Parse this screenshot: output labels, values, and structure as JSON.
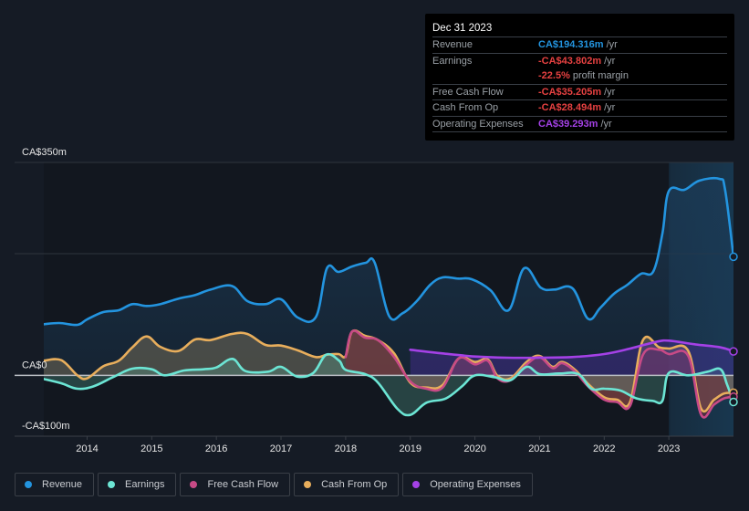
{
  "tooltip": {
    "date": "Dec 31 2023",
    "rows": [
      {
        "label": "Revenue",
        "value": "CA$194.316m",
        "unit": "/yr",
        "color": "#2394df"
      },
      {
        "label": "Earnings",
        "value": "-CA$43.802m",
        "unit": "/yr",
        "color": "#e64141"
      },
      {
        "label": "",
        "value": "-22.5%",
        "unit": "profit margin",
        "color": "#e64141"
      },
      {
        "label": "Free Cash Flow",
        "value": "-CA$35.205m",
        "unit": "/yr",
        "color": "#e64141"
      },
      {
        "label": "Cash From Op",
        "value": "-CA$28.494m",
        "unit": "/yr",
        "color": "#e64141"
      },
      {
        "label": "Operating Expenses",
        "value": "CA$39.293m",
        "unit": "/yr",
        "color": "#a441e6"
      }
    ]
  },
  "legend": [
    {
      "label": "Revenue",
      "color": "#2394df"
    },
    {
      "label": "Earnings",
      "color": "#6ce5d4"
    },
    {
      "label": "Free Cash Flow",
      "color": "#c74a86"
    },
    {
      "label": "Cash From Op",
      "color": "#e8ae5c"
    },
    {
      "label": "Operating Expenses",
      "color": "#a441e6"
    }
  ],
  "chart_data": {
    "type": "line",
    "title": "",
    "xlabel": "",
    "ylabel": "",
    "y_tick_labels": [
      "CA$350m",
      "CA$0",
      "-CA$100m"
    ],
    "y_ticks": [
      350,
      0,
      -100
    ],
    "ylim": [
      -100,
      350
    ],
    "xlim": [
      2013.33,
      2024.0
    ],
    "x_tick_labels": [
      "2014",
      "2015",
      "2016",
      "2017",
      "2018",
      "2019",
      "2020",
      "2021",
      "2022",
      "2023"
    ],
    "x_ticks": [
      2014,
      2015,
      2016,
      2017,
      2018,
      2019,
      2020,
      2021,
      2022,
      2023
    ],
    "highlight_from": 2023.0,
    "legend_position": "bottom-left",
    "grid": true,
    "series": [
      {
        "name": "Revenue",
        "color": "#2394df",
        "x": [
          2013.33,
          2013.57,
          2013.85,
          2014.0,
          2014.25,
          2014.49,
          2014.7,
          2014.92,
          2015.13,
          2015.41,
          2015.67,
          2015.91,
          2016.24,
          2016.48,
          2016.76,
          2017.0,
          2017.26,
          2017.54,
          2017.71,
          2017.89,
          2018.1,
          2018.31,
          2018.45,
          2018.67,
          2018.88,
          2019.1,
          2019.31,
          2019.5,
          2019.74,
          2019.95,
          2020.24,
          2020.52,
          2020.76,
          2021.02,
          2021.23,
          2021.51,
          2021.75,
          2021.94,
          2022.15,
          2022.36,
          2022.57,
          2022.76,
          2022.9,
          2023.0,
          2023.24,
          2023.47,
          2023.78,
          2023.87,
          2024.0
        ],
        "values": [
          84,
          86,
          83,
          92,
          104,
          107,
          117,
          114,
          117,
          126,
          132,
          141,
          147,
          122,
          117,
          125,
          95,
          96,
          176,
          170,
          179,
          185,
          185,
          98,
          102,
          122,
          149,
          161,
          159,
          158,
          140,
          107,
          176,
          144,
          141,
          143,
          93,
          111,
          134,
          149,
          167,
          171,
          233,
          303,
          305,
          320,
          323,
          305,
          195
        ]
      },
      {
        "name": "Earnings",
        "color": "#6ce5d4",
        "x": [
          2013.33,
          2013.6,
          2013.85,
          2014.1,
          2014.4,
          2014.7,
          2015.0,
          2015.2,
          2015.5,
          2015.8,
          2016.0,
          2016.25,
          2016.45,
          2016.8,
          2017.0,
          2017.25,
          2017.5,
          2017.7,
          2017.9,
          2018.0,
          2018.3,
          2018.5,
          2018.8,
          2019.0,
          2019.25,
          2019.55,
          2019.8,
          2020.0,
          2020.3,
          2020.55,
          2020.8,
          2021.0,
          2021.3,
          2021.6,
          2021.8,
          2022.0,
          2022.25,
          2022.5,
          2022.75,
          2022.9,
          2023.0,
          2023.3,
          2023.6,
          2023.8,
          2023.9,
          2024.0
        ],
        "values": [
          -6,
          -13,
          -22,
          -18,
          -3,
          11,
          10,
          0,
          8,
          10,
          13,
          27,
          7,
          6,
          14,
          -2,
          4,
          34,
          24,
          9,
          2,
          -12,
          -55,
          -65,
          -45,
          -38,
          -18,
          0,
          -3,
          -8,
          14,
          2,
          3,
          2,
          -22,
          -22,
          -25,
          -38,
          -42,
          -42,
          4,
          0,
          6,
          10,
          -15,
          -43.8
        ]
      },
      {
        "name": "Free Cash Flow",
        "color": "#c74a86",
        "x": [
          2018.0,
          2018.1,
          2018.3,
          2018.5,
          2018.75,
          2019.0,
          2019.25,
          2019.5,
          2019.75,
          2020.0,
          2020.2,
          2020.35,
          2020.55,
          2020.8,
          2021.0,
          2021.2,
          2021.35,
          2021.55,
          2021.75,
          2022.0,
          2022.2,
          2022.4,
          2022.6,
          2022.85,
          2023.0,
          2023.3,
          2023.5,
          2023.7,
          2023.85,
          2024.0
        ],
        "values": [
          30,
          72,
          62,
          58,
          30,
          -10,
          -22,
          -20,
          28,
          18,
          24,
          -5,
          -8,
          18,
          30,
          12,
          20,
          6,
          -18,
          -40,
          -44,
          -50,
          34,
          42,
          35,
          32,
          -65,
          -48,
          -38,
          -35.2
        ]
      },
      {
        "name": "Cash From Op",
        "color": "#e8ae5c",
        "x": [
          2013.33,
          2013.6,
          2013.85,
          2014.0,
          2014.25,
          2014.49,
          2014.7,
          2014.92,
          2015.13,
          2015.41,
          2015.67,
          2015.91,
          2016.24,
          2016.48,
          2016.76,
          2017.0,
          2017.26,
          2017.54,
          2017.71,
          2017.89,
          2018.0,
          2018.1,
          2018.3,
          2018.5,
          2018.75,
          2019.0,
          2019.25,
          2019.5,
          2019.75,
          2020.0,
          2020.2,
          2020.35,
          2020.55,
          2020.8,
          2021.0,
          2021.2,
          2021.35,
          2021.55,
          2021.75,
          2022.0,
          2022.2,
          2022.4,
          2022.6,
          2022.85,
          2023.0,
          2023.3,
          2023.5,
          2023.7,
          2023.85,
          2024.0
        ],
        "values": [
          24,
          25,
          0,
          -5,
          15,
          24,
          46,
          64,
          47,
          40,
          59,
          58,
          68,
          68,
          50,
          49,
          41,
          30,
          34,
          35,
          32,
          72,
          65,
          58,
          36,
          -12,
          -20,
          -16,
          28,
          22,
          26,
          -1,
          -5,
          22,
          32,
          14,
          22,
          9,
          -14,
          -36,
          -40,
          -44,
          58,
          46,
          44,
          40,
          -55,
          -40,
          -30,
          -28.5
        ]
      },
      {
        "name": "Operating Expenses",
        "color": "#a441e6",
        "x": [
          2019.0,
          2019.5,
          2020.0,
          2020.5,
          2021.0,
          2021.5,
          2022.0,
          2022.4,
          2022.8,
          2023.0,
          2023.4,
          2023.8,
          2024.0
        ],
        "values": [
          42,
          36,
          31,
          29,
          29,
          30,
          35,
          44,
          55,
          57,
          51,
          46,
          39.3
        ]
      }
    ]
  }
}
